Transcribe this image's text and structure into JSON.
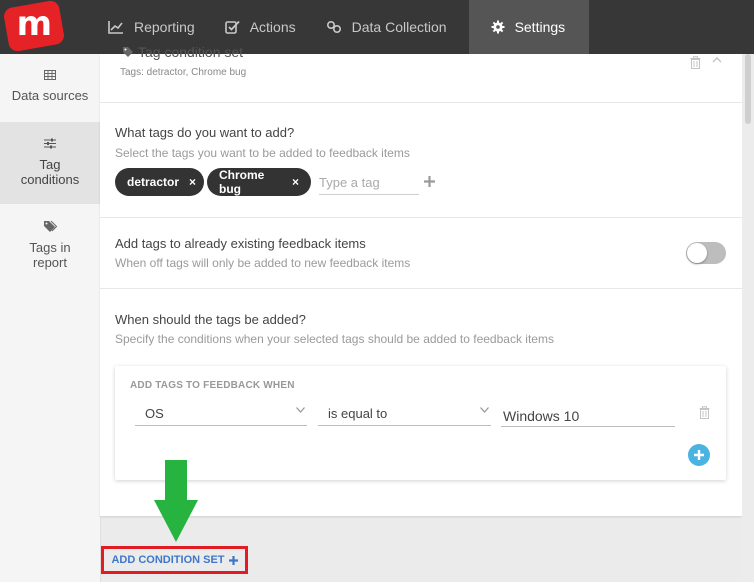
{
  "nav": {
    "logo_letter": "m",
    "items": [
      {
        "label": "Reporting",
        "icon": "chart-line-icon"
      },
      {
        "label": "Actions",
        "icon": "check-square-icon"
      },
      {
        "label": "Data Collection",
        "icon": "link-icon"
      },
      {
        "label": "Settings",
        "icon": "gear-icon"
      }
    ],
    "active": "Settings"
  },
  "sidebar": {
    "items": [
      {
        "label": "Data sources",
        "icon": "table-icon"
      },
      {
        "label_line1": "Tag",
        "label_line2": "conditions",
        "icon": "sliders-icon"
      },
      {
        "label_line1": "Tags in",
        "label_line2": "report",
        "icon": "tags-icon"
      }
    ],
    "active": "Tag conditions"
  },
  "condition_set": {
    "title": "Tag condition set",
    "subtitle": "Tags: detractor, Chrome bug"
  },
  "tags_section": {
    "title": "What tags do you want to add?",
    "description": "Select the tags you want to be added to feedback items",
    "tags": [
      "detractor",
      "Chrome bug"
    ],
    "tag_input_placeholder": "Type a tag",
    "remove_glyph": "×"
  },
  "existing_section": {
    "title": "Add tags to already existing feedback items",
    "description": "When off tags will only be added to new feedback items",
    "toggle_on": false
  },
  "when_section": {
    "title": "When should the tags be added?",
    "description": "Specify the conditions when your selected tags should be added to feedback items",
    "box_header": "ADD TAGS TO FEEDBACK WHEN",
    "field_value": "OS",
    "operator_value": "is equal to",
    "text_value": "Windows 10"
  },
  "footer": {
    "add_condition_set_label": "ADD CONDITION SET"
  },
  "colors": {
    "brand": "#e52226",
    "nav_bg": "#373737",
    "link_blue": "#3f77c8",
    "plus_blue": "#4ab3e2",
    "highlight_red": "#e31b23",
    "arrow_green": "#27b33f"
  }
}
